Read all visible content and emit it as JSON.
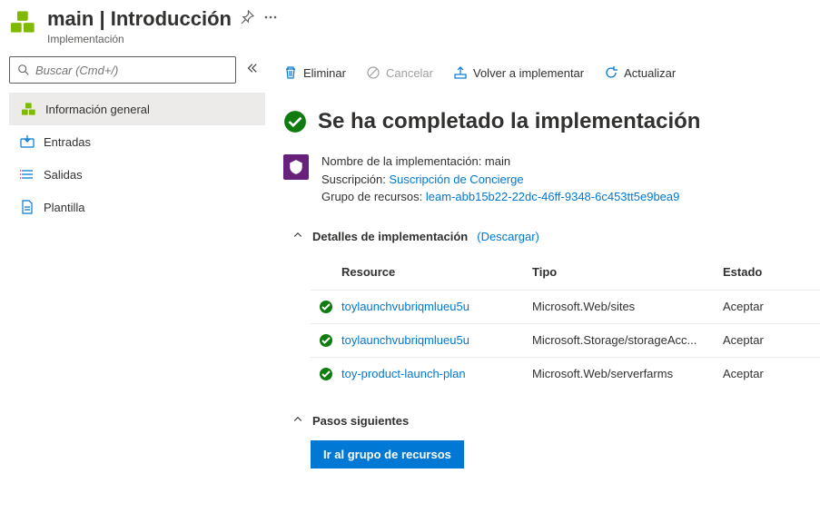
{
  "header": {
    "title": "main | Introducción",
    "subtitle": "Implementación"
  },
  "search": {
    "placeholder": "Buscar (Cmd+/)"
  },
  "nav": {
    "items": [
      {
        "label": "Información general"
      },
      {
        "label": "Entradas"
      },
      {
        "label": "Salidas"
      },
      {
        "label": "Plantilla"
      }
    ]
  },
  "toolbar": {
    "delete": "Eliminar",
    "cancel": "Cancelar",
    "redeploy": "Volver a implementar",
    "refresh": "Actualizar"
  },
  "status": {
    "title": "Se ha completado la implementación"
  },
  "meta": {
    "deploy_label": "Nombre de la implementación: ",
    "deploy_name": "main",
    "sub_label": "Suscripción: ",
    "sub_link": "Suscripción de Concierge",
    "rg_label": "Grupo de recursos: ",
    "rg_link": "leam-abb15b22-22dc-46ff-9348-6c453tt5e9bea9"
  },
  "sections": {
    "details": "Detalles de implementación",
    "download": "(Descargar)",
    "next": "Pasos siguientes"
  },
  "table": {
    "head": {
      "resource": "Resource",
      "type": "Tipo",
      "state": "Estado"
    },
    "rows": [
      {
        "name": "toylaunchvubriqmlueu5u",
        "type": "Microsoft.Web/sites",
        "state": "Aceptar"
      },
      {
        "name": "toylaunchvubriqmlueu5u",
        "type": "Microsoft.Storage/storageAcc...",
        "state": "Aceptar"
      },
      {
        "name": "toy-product-launch-plan",
        "type": "Microsoft.Web/serverfarms",
        "state": "Aceptar"
      }
    ]
  },
  "buttons": {
    "go_rg": "Ir al grupo de recursos"
  }
}
